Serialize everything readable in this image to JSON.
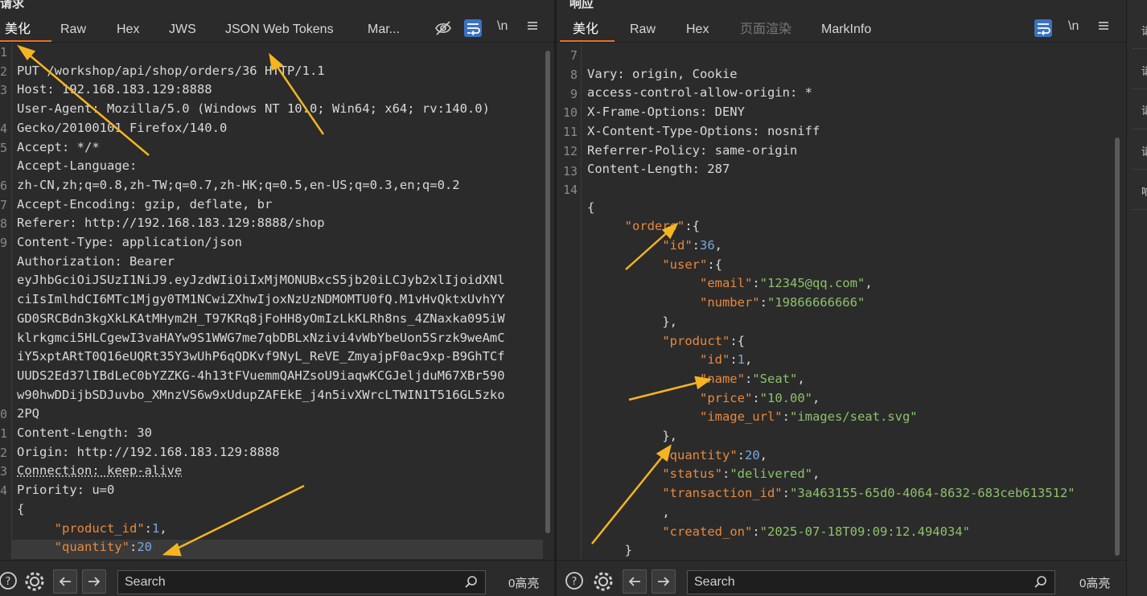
{
  "request": {
    "title": "请求",
    "tabs": [
      "美化",
      "Raw",
      "Hex",
      "JWS",
      "JSON Web Tokens",
      "Mar..."
    ],
    "active_tab": "美化",
    "newline_label": "\\n",
    "line_numbers": [
      "1",
      "2",
      "3",
      "",
      "4",
      "5",
      "",
      "6",
      "7",
      "8",
      "9",
      "",
      "",
      "",
      "",
      "",
      "",
      "",
      "",
      "",
      "0",
      "1",
      "2",
      "3",
      "4",
      "",
      "",
      ""
    ],
    "lines": [
      "PUT /workshop/api/shop/orders/36 HTTP/1.1",
      "Host: 192.168.183.129:8888",
      "User-Agent: Mozilla/5.0 (Windows NT 10.0; Win64; x64; rv:140.0)",
      "Gecko/20100101 Firefox/140.0",
      "Accept: */*",
      "Accept-Language:",
      "zh-CN,zh;q=0.8,zh-TW;q=0.7,zh-HK;q=0.5,en-US;q=0.3,en;q=0.2",
      "Accept-Encoding: gzip, deflate, br",
      "Referer: http://192.168.183.129:8888/shop",
      "Content-Type: application/json",
      "Authorization: Bearer",
      "eyJhbGciOiJSUzI1NiJ9.eyJzdWIiOiIxMjMONUBxcS5jb20iLCJyb2xlIjoidXNl",
      "ciIsImlhdCI6MTc1Mjgy0TM1NCwiZXhwIjoxNzUzNDMOMTU0fQ.M1vHvQktxUvhYY",
      "GD0SRCBdn3kgXkLKAtMHym2H_T97KRq8jFoHH8yOmIzLkKLRh8ns_4ZNaxka095iW",
      "klrkgmci5HLCgewI3vaHAYw9S1WWG7me7qbDBLxNzivi4vWbYbeUon5Srzk9weAmC",
      "iY5xptARtT0Q16eUQRt35Y3wUhP6qQDKvf9NyL_ReVE_ZmyajpF0ac9xp-B9GhTCf",
      "UUDS2Ed37lIBdLeC0bYZZKG-4h13tFVuemmQAHZsoU9iaqwKCGJeljduM67XBr590",
      "w90hwDDijbSDJuvbo_XMnzVS6w9xUdupZAFEkE_j4n5ivXWrcLTWIN1T516GL5zko",
      "2PQ",
      "Content-Length: 30",
      "Origin: http://192.168.183.129:8888",
      "Connection: keep-alive",
      "Priority: u=0",
      "",
      "{",
      "     \"product_id\":1,",
      "     \"quantity\":20",
      ""
    ],
    "json_body": {
      "product_id_key": "\"product_id\"",
      "product_id_val": "1",
      "quantity_key": "\"quantity\"",
      "quantity_val": "20"
    },
    "search_placeholder": "Search",
    "highlights": "0高亮"
  },
  "response": {
    "title": "响应",
    "tabs": [
      "美化",
      "Raw",
      "Hex",
      "页面渲染",
      "MarkInfo"
    ],
    "active_tab": "美化",
    "newline_label": "\\n",
    "line_numbers": [
      "7",
      "8",
      "9",
      "10",
      "11",
      "12",
      "13",
      "14"
    ],
    "headers": [
      "Vary: origin, Cookie",
      "access-control-allow-origin: *",
      "X-Frame-Options: DENY",
      "X-Content-Type-Options: nosniff",
      "Referrer-Policy: same-origin",
      "Content-Length: 287"
    ],
    "body": {
      "orders_key": "\"orders\"",
      "id_key": "\"id\"",
      "id_val": "36",
      "user_key": "\"user\"",
      "email_key": "\"email\"",
      "email_val": "\"12345@qq.com\"",
      "number_key": "\"number\"",
      "number_val": "\"19866666666\"",
      "product_key": "\"product\"",
      "pid_key": "\"id\"",
      "pid_val": "1",
      "name_key": "\"name\"",
      "name_val": "\"Seat\"",
      "price_key": "\"price\"",
      "price_val": "\"10.00\"",
      "image_key": "\"image_url\"",
      "image_val": "\"images/seat.svg\"",
      "quantity_key": "\"quantity\"",
      "quantity_val": "20",
      "status_key": "\"status\"",
      "status_val": "\"delivered\"",
      "txn_key": "\"transaction_id\"",
      "txn_val": "\"3a463155-65d0-4064-8632-683ceb613512\"",
      "created_key": "\"created_on\"",
      "created_val": "\"2025-07-18T09:09:12.494034\""
    },
    "search_placeholder": "Search",
    "highlights": "0高亮"
  },
  "sidebar": {
    "items": [
      "请",
      "请",
      "请",
      "请",
      "响"
    ]
  },
  "colors": {
    "accent_tab": "#e8702a",
    "key": "#e8893c",
    "string": "#8cc26a",
    "number": "#79a8e0",
    "arrow": "#f5b521"
  }
}
